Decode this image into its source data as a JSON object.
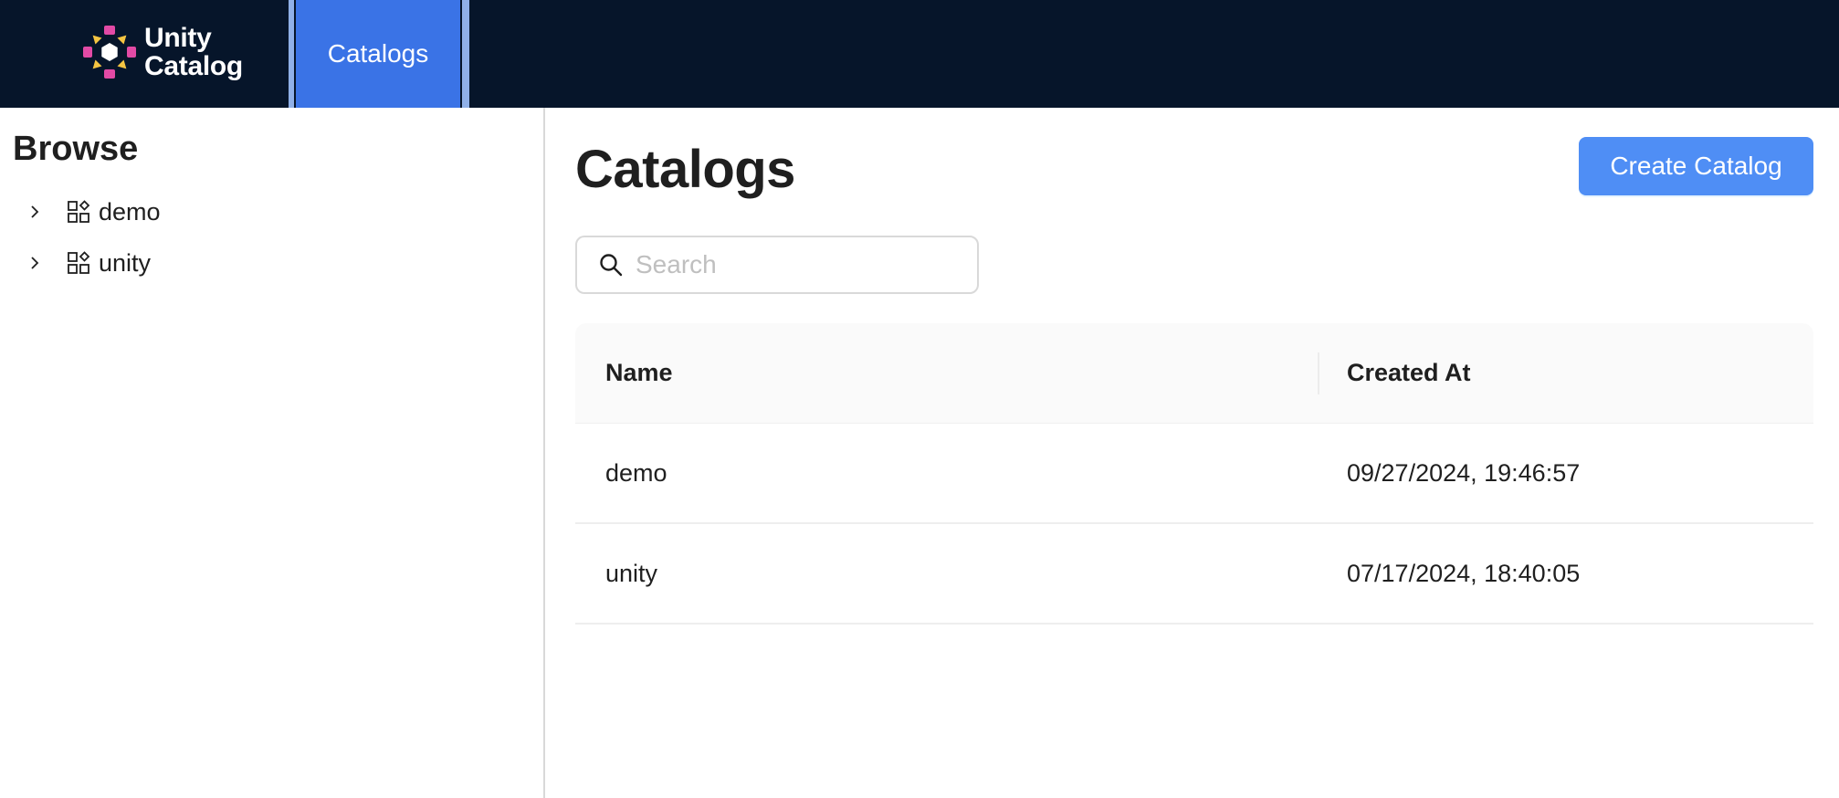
{
  "header": {
    "logo_line1": "Unity",
    "logo_line2": "Catalog",
    "nav_tabs": [
      {
        "label": "Catalogs",
        "active": true
      }
    ],
    "colors": {
      "background": "#06152a",
      "active_tab": "#3a73e6"
    }
  },
  "sidebar": {
    "title": "Browse",
    "items": [
      {
        "label": "demo",
        "icon": "catalog-icon",
        "expand_icon": "chevron-right-icon"
      },
      {
        "label": "unity",
        "icon": "catalog-icon",
        "expand_icon": "chevron-right-icon"
      }
    ]
  },
  "main": {
    "title": "Catalogs",
    "create_button": "Create Catalog",
    "search": {
      "placeholder": "Search",
      "value": "",
      "icon": "search-icon"
    },
    "table": {
      "columns": [
        "Name",
        "Created At"
      ],
      "rows": [
        {
          "name": "demo",
          "created_at": "09/27/2024, 19:46:57"
        },
        {
          "name": "unity",
          "created_at": "07/17/2024, 18:40:05"
        }
      ]
    },
    "colors": {
      "primary_button": "#4f8ef5"
    }
  }
}
